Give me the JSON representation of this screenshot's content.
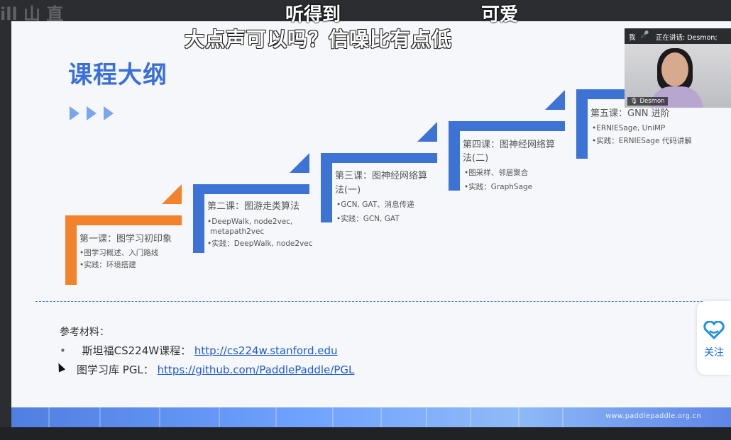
{
  "overlay": {
    "top_caption_1": "听得到",
    "top_caption_2": "可爱",
    "main_caption": "大点声可以吗？信噪比有点低",
    "speaker_me": "我",
    "speaker_text": "正在讲话: Desmon;",
    "video_name": "Desmon",
    "follow_label": "关注",
    "left_deco": "ill 山 直"
  },
  "slide": {
    "title": "课程大纲",
    "steps": [
      {
        "title": "第一课：图学习初印象",
        "items": [
          "•图学习概述、入门路线",
          "•实践：环境搭建"
        ],
        "color": "#f2822c"
      },
      {
        "title": "第二课：图游走类算法",
        "items": [
          "•DeepWalk, node2vec,",
          "metapath2vec",
          "•实践：DeepWalk, node2vec"
        ],
        "color": "#3e73d6"
      },
      {
        "title": "第三课：图神经网络算",
        "title2": "法(一)",
        "items": [
          "•GCN, GAT、消息传递",
          "•实践：GCN, GAT"
        ],
        "color": "#3e73d6"
      },
      {
        "title": "第四课：图神经网络算",
        "title2": "法(二)",
        "items": [
          "•图采样、邻居聚合",
          "•实践：GraphSage"
        ],
        "color": "#3e73d6"
      },
      {
        "title": "第五课：GNN 进阶",
        "items": [
          "•ERNIESage, UniMP",
          "•实践：ERNIESage 代码讲解"
        ],
        "color": "#3e73d6"
      }
    ],
    "references": {
      "heading": "参考材料：",
      "bullet": "•",
      "line1_prefix": "斯坦福CS224W课程：",
      "line1_link": "http://cs224w.stanford.edu",
      "line2_prefix": "图学习库 PGL：",
      "line2_link": "https://github.com/PaddlePaddle/PGL"
    },
    "footer_url": "www.paddlepaddle.org.cn"
  },
  "colors": {
    "accent_blue": "#3e73d6",
    "accent_orange": "#f2822c",
    "title_blue": "#3b6fd8"
  }
}
